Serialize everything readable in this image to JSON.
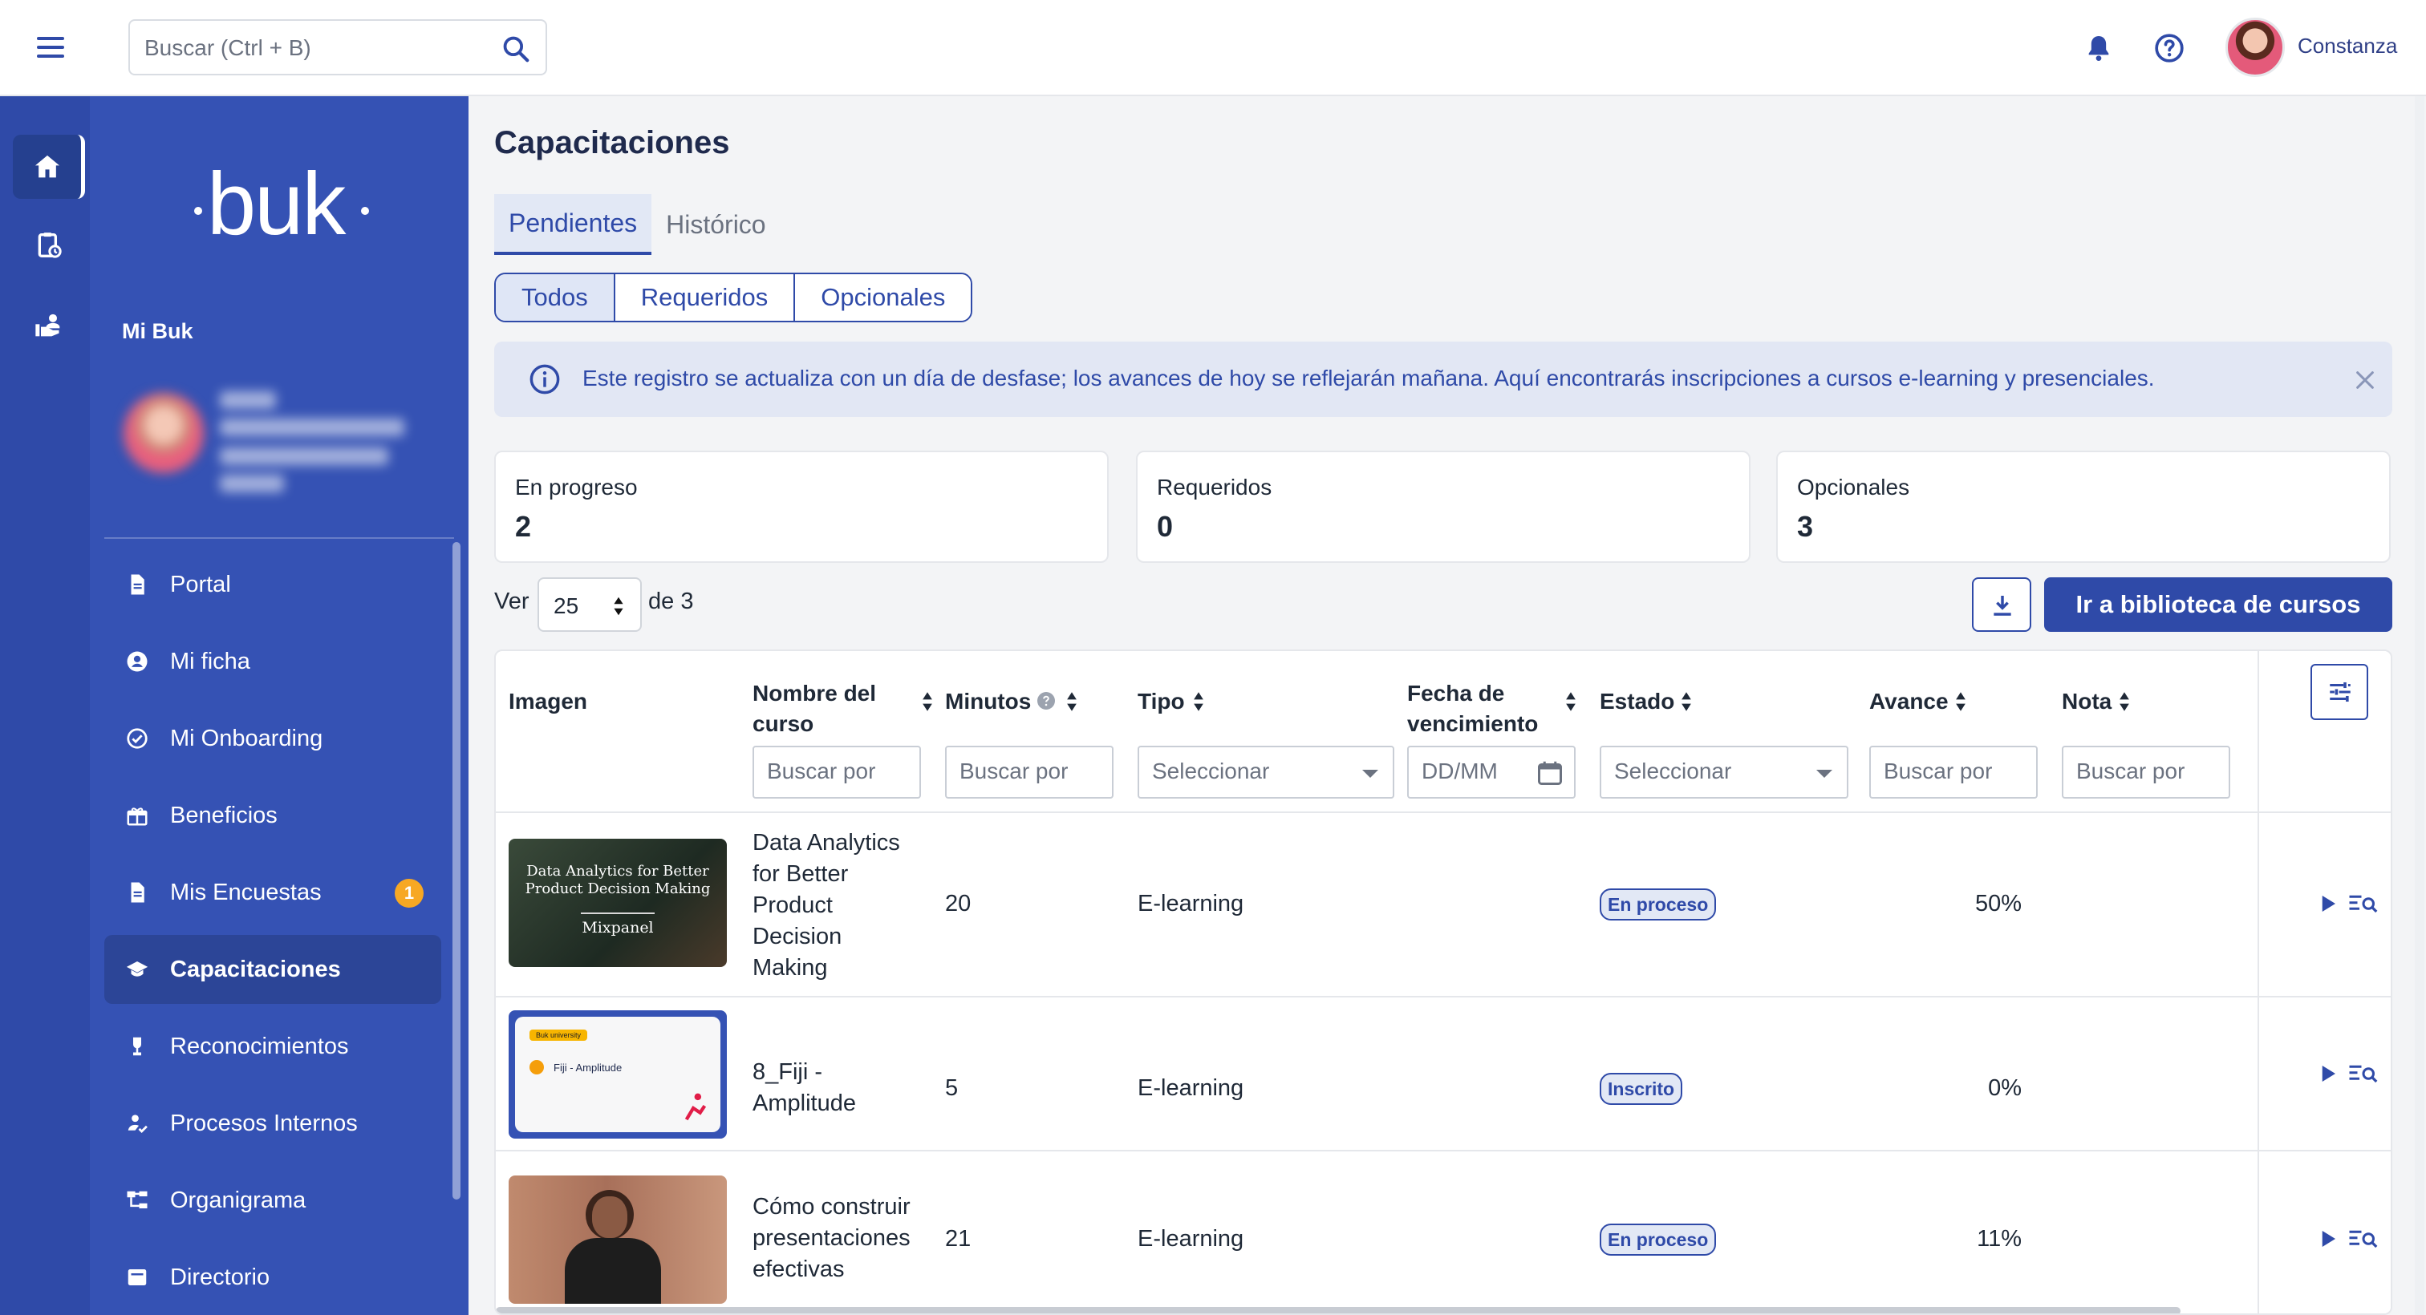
{
  "topbar": {
    "search_placeholder": "Buscar (Ctrl + B)",
    "user_name": "Constanza"
  },
  "sidebar": {
    "logo": "buk",
    "section_title": "Mi Buk",
    "items": [
      {
        "label": "Portal",
        "icon": "document-icon"
      },
      {
        "label": "Mi ficha",
        "icon": "user-circle-icon"
      },
      {
        "label": "Mi Onboarding",
        "icon": "check-circle-icon"
      },
      {
        "label": "Beneficios",
        "icon": "gift-icon"
      },
      {
        "label": "Mis Encuestas",
        "icon": "document-icon",
        "badge": "1"
      },
      {
        "label": "Capacitaciones",
        "icon": "graduation-cap-icon",
        "active": true
      },
      {
        "label": "Reconocimientos",
        "icon": "trophy-icon"
      },
      {
        "label": "Procesos Internos",
        "icon": "user-process-icon"
      },
      {
        "label": "Organigrama",
        "icon": "org-chart-icon"
      },
      {
        "label": "Directorio",
        "icon": "directory-icon"
      }
    ]
  },
  "main": {
    "title": "Capacitaciones",
    "tabs": [
      {
        "label": "Pendientes",
        "active": true
      },
      {
        "label": "Histórico",
        "active": false
      }
    ],
    "segments": [
      {
        "label": "Todos",
        "active": true
      },
      {
        "label": "Requeridos",
        "active": false
      },
      {
        "label": "Opcionales",
        "active": false
      }
    ],
    "alert": "Este registro se actualiza con un día de desfase; los avances de hoy se reflejarán mañana. Aquí encontrarás inscripciones a cursos e-learning y presenciales.",
    "stats": [
      {
        "label": "En progreso",
        "value": "2"
      },
      {
        "label": "Requeridos",
        "value": "0"
      },
      {
        "label": "Opcionales",
        "value": "3"
      }
    ],
    "pager": {
      "ver": "Ver",
      "page_size": "25",
      "de": "de 3"
    },
    "library_button": "Ir a biblioteca de cursos"
  },
  "table": {
    "columns": {
      "imagen": "Imagen",
      "nombre": "Nombre del curso",
      "minutos": "Minutos",
      "tipo": "Tipo",
      "fecha": "Fecha de vencimiento",
      "estado": "Estado",
      "avance": "Avance",
      "nota": "Nota"
    },
    "filters": {
      "nombre": "Buscar por",
      "minutos": "Buscar por",
      "tipo": "Seleccionar",
      "fecha": "DD/MM",
      "estado": "Seleccionar",
      "avance": "Buscar por",
      "nota": "Buscar por"
    },
    "rows": [
      {
        "name": "Data Analytics for Better Product Decision Making",
        "minutes": "20",
        "type": "E-learning",
        "status": "En proceso",
        "progress": "50%",
        "thumb_title": "Data Analytics for Better Product Decision Making",
        "thumb_sub": "Mixpanel"
      },
      {
        "name": "8_Fiji - Amplitude",
        "minutes": "5",
        "type": "E-learning",
        "status": "Inscrito",
        "progress": "0%",
        "thumb_tag": "Buk university",
        "thumb_title": "Fiji - Amplitude"
      },
      {
        "name": "Cómo construir presentaciones efectivas",
        "minutes": "21",
        "type": "E-learning",
        "status": "En proceso",
        "progress": "11%"
      }
    ]
  },
  "colors": {
    "primary": "#2f4aa8",
    "sidebar": "#3552b4",
    "rail": "#2f4aa8",
    "badge": "#f7a823"
  }
}
